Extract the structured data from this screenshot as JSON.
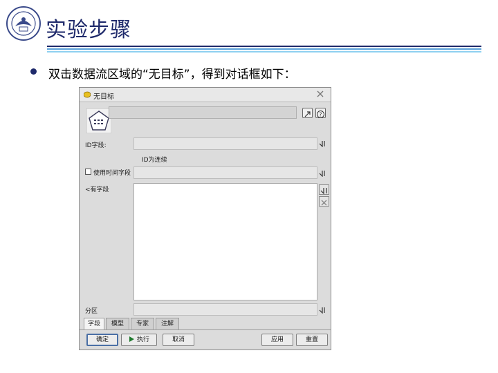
{
  "slide": {
    "title": "实验步骤",
    "bullet": "双击数据流区域的“无目标”，得到对话框如下："
  },
  "colors": {
    "title": "#1f2a6b",
    "rule_top": "#1f2a6b",
    "rule_mid": "#5aa0d8",
    "rule_bottom": "#8ed0f0"
  },
  "dialog": {
    "title": "无目标",
    "title_icon": "diamond-node-icon",
    "labels": {
      "id_field": "ID字段:",
      "id_continuous": "ID为连续",
      "use_time_field": "使用时间字段",
      "inputs": "<有字段",
      "partition": "分区"
    },
    "tabs": [
      "字段",
      "模型",
      "专家",
      "注解"
    ],
    "active_tab": "字段",
    "buttons": {
      "ok": "确定",
      "run": "执行",
      "cancel": "取消",
      "apply": "应用",
      "reset": "重置"
    }
  }
}
